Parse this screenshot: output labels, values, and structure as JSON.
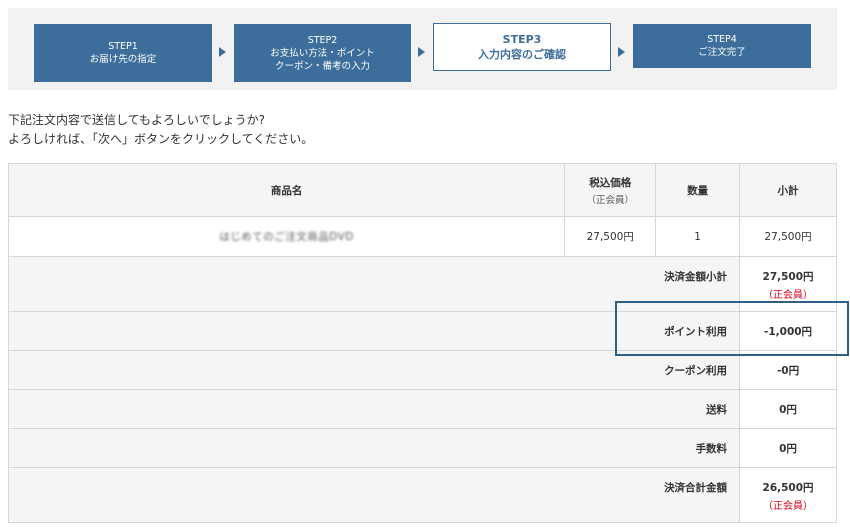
{
  "steps": [
    {
      "num": "STEP1",
      "label": "お届け先の指定"
    },
    {
      "num": "STEP2",
      "label": "お支払い方法・ポイント",
      "label2": "クーポン・備考の入力"
    },
    {
      "num": "STEP3",
      "label": "入力内容のご確認"
    },
    {
      "num": "STEP4",
      "label": "ご注文完了"
    }
  ],
  "message": {
    "line1": "下記注文内容で送信してもよろしいでしょうか?",
    "line2": "よろしければ、「次へ」ボタンをクリックしてください。"
  },
  "table": {
    "headers": {
      "product": "商品名",
      "price": "税込価格",
      "price_sub": "（正会員）",
      "qty": "数量",
      "subtotal": "小計"
    },
    "item": {
      "name": "はじめてのご注文商品DVD",
      "price": "27,500円",
      "qty": "1",
      "subtotal": "27,500円"
    },
    "summary": [
      {
        "label": "決済金額小計",
        "value": "27,500円",
        "note": "（正会員）"
      },
      {
        "label": "ポイント利用",
        "value": "-1,000円"
      },
      {
        "label": "クーポン利用",
        "value": "-0円"
      },
      {
        "label": "送料",
        "value": "0円"
      },
      {
        "label": "手数料",
        "value": "0円"
      },
      {
        "label": "決済合計金額",
        "value": "26,500円",
        "note": "（正会員）"
      }
    ]
  },
  "colors": {
    "step_bg": "#3d6e9b",
    "member_note": "#d0021b",
    "highlight": "#2f5f87"
  }
}
